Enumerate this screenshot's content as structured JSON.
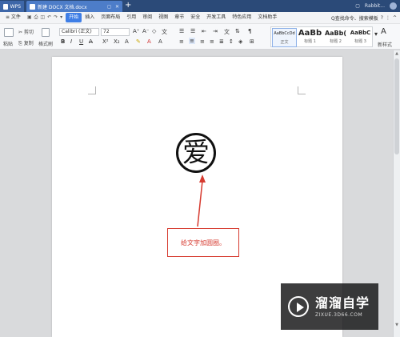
{
  "titlebar": {
    "app_tab": "WPS",
    "doc_tab": "新建 DOCX 文档.docx",
    "user": "Rabbit..."
  },
  "menubar": {
    "file": "≡ 文件",
    "items": [
      "开始",
      "插入",
      "页面布局",
      "引用",
      "审阅",
      "视图",
      "章节",
      "安全",
      "开发工具",
      "特色应用",
      "文档助手"
    ],
    "search": "Q查找命令、搜索模板"
  },
  "ribbon": {
    "paste": "粘贴",
    "cut": "剪切",
    "copy": "复制",
    "format_painter": "格式刷",
    "font_name": "Calibri (正文)",
    "font_size": "72",
    "styles": [
      {
        "preview": "AaBbCcDd",
        "label": "正文"
      },
      {
        "preview": "AaBb",
        "label": "标题 1"
      },
      {
        "preview": "AaBb(",
        "label": "标题 2"
      },
      {
        "preview": "AaBbC",
        "label": "标题 3"
      }
    ],
    "new_style": "新样式"
  },
  "document": {
    "enclosed_char": "爱",
    "annotation": "给文字加圆圈。"
  },
  "watermark": {
    "title": "溜溜自学",
    "url": "ZIXUE.3D66.COM"
  },
  "colors": {
    "titlebar": "#2b4a78",
    "active_tab": "#3e7ee6",
    "annotation_red": "#d63a2f"
  }
}
